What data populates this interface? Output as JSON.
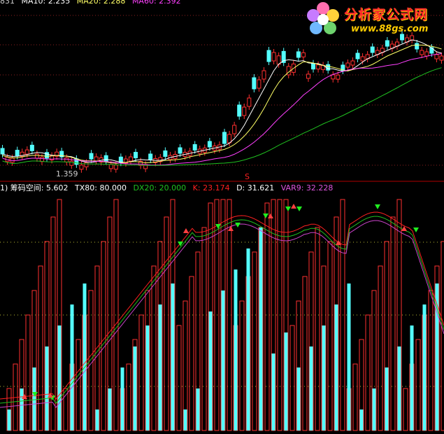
{
  "top_legend": {
    "code": "831",
    "ma10_label": "MA10: 2.235",
    "ma20_label": "MA20: 2.288",
    "ma60_label": "MA60: 2.392"
  },
  "price_low_label": "1.359",
  "s_marker": "S",
  "indicator_legend": {
    "prefix": "1)",
    "name": "筹码空间: 5.602",
    "tx80": "TX80: 80.000",
    "dx20": "DX20: 20.000",
    "k": "K: 23.174",
    "d": "D: 31.621",
    "var9": "VAR9: 32.228"
  },
  "logo": {
    "title": "分析家公式网",
    "url": "www.88gs.com"
  },
  "colors": {
    "background": "#000000",
    "up": "#ff3030",
    "down": "#54ffff",
    "ma10": "#ffffff",
    "ma20": "#ffff66",
    "ma60": "#ff40ff",
    "ma120": "#20c020",
    "dx20": "#20c020",
    "k": "#ff2020",
    "var9": "#cc44cc",
    "text_code": "#cccccc"
  }
}
